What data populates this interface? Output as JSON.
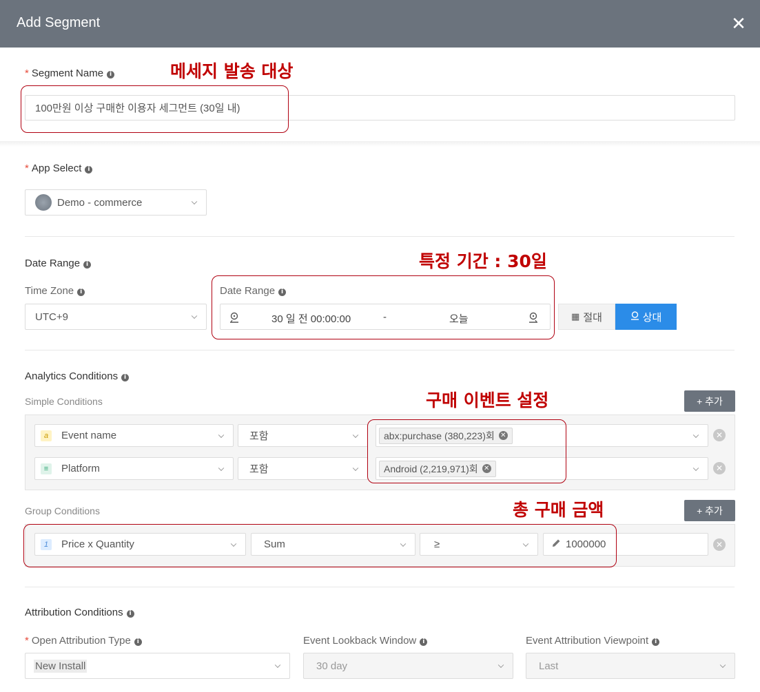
{
  "header": {
    "title": "Add Segment",
    "close_symbol": "✕"
  },
  "segment_name": {
    "required": "*",
    "label": "Segment Name",
    "value": "100만원 이상 구매한 이용자 세그먼트 (30일 내)",
    "annotation": "메세지 발송 대상"
  },
  "app_select": {
    "required": "*",
    "label": "App Select",
    "value": "Demo - commerce"
  },
  "date_range": {
    "section_label": "Date Range",
    "time_zone_label": "Time Zone",
    "time_zone_value": "UTC+9",
    "range_label": "Date Range",
    "start": "30 일 전 00:00:00",
    "separator": "-",
    "end": "오늘",
    "absolute_button": "절대",
    "relative_button": "상대",
    "annotation": "특정 기간 : 30일"
  },
  "analytics": {
    "section_label": "Analytics Conditions",
    "simple_label": "Simple Conditions",
    "add_button": "+ 추가",
    "simple_annotation": "구매 이벤트 설정",
    "simple_rows": [
      {
        "badge": "a",
        "field": "Event name",
        "operator": "포함",
        "tag": "abx:purchase (380,223)회"
      },
      {
        "badge": "≡",
        "field": "Platform",
        "operator": "포함",
        "tag": "Android (2,219,971)회"
      }
    ],
    "group_label": "Group Conditions",
    "group_add_button": "+ 추가",
    "group_annotation": "총 구매 금액",
    "group_row": {
      "badge": "1",
      "field": "Price x Quantity",
      "aggregate": "Sum",
      "comparator": "≥",
      "value": "1000000"
    }
  },
  "attribution": {
    "section_label": "Attribution Conditions",
    "open_type_required": "*",
    "open_type_label": "Open Attribution Type",
    "open_type_value": "New Install",
    "lookback_label": "Event Lookback Window",
    "lookback_value": "30 day",
    "viewpoint_label": "Event Attribution Viewpoint",
    "viewpoint_value": "Last"
  },
  "info_symbol": "i",
  "remove_symbol": "✕"
}
